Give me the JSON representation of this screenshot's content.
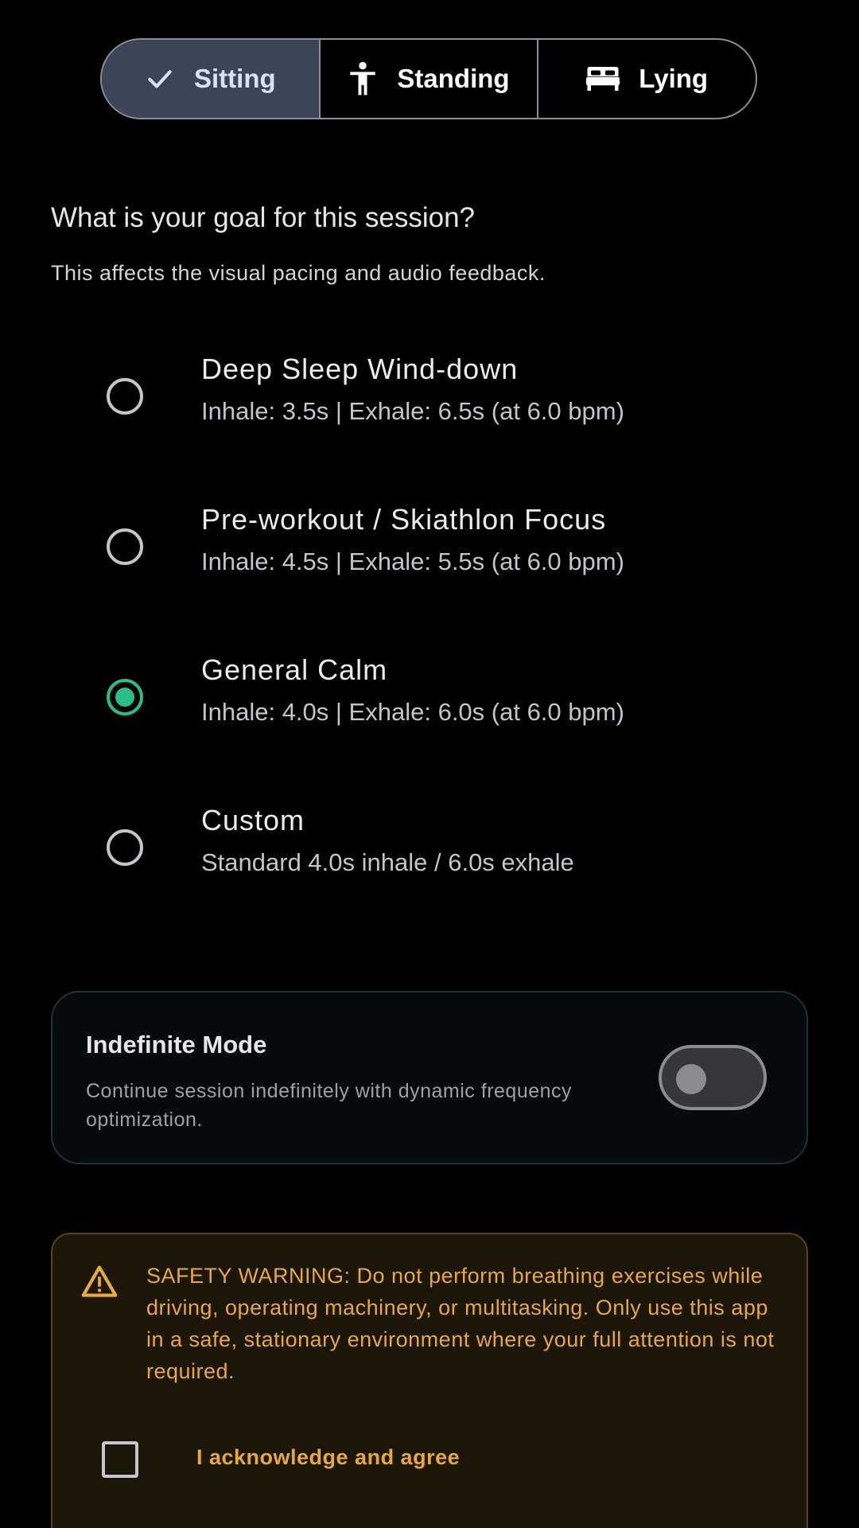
{
  "posture": {
    "options": [
      {
        "label": "Sitting",
        "icon": "check-icon",
        "selected": true
      },
      {
        "label": "Standing",
        "icon": "person-standing-icon",
        "selected": false
      },
      {
        "label": "Lying",
        "icon": "bed-icon",
        "selected": false
      }
    ]
  },
  "goal": {
    "question": "What is your goal for this session?",
    "hint": "This affects the visual pacing and audio feedback.",
    "options": [
      {
        "title": "Deep Sleep Wind-down",
        "subtitle": "Inhale: 3.5s | Exhale: 6.5s (at 6.0 bpm)",
        "checked": false
      },
      {
        "title": "Pre-workout / Skiathlon Focus",
        "subtitle": "Inhale: 4.5s | Exhale: 5.5s (at 6.0 bpm)",
        "checked": false
      },
      {
        "title": "General Calm",
        "subtitle": "Inhale: 4.0s | Exhale: 6.0s (at 6.0 bpm)",
        "checked": true
      },
      {
        "title": "Custom",
        "subtitle": "Standard 4.0s inhale / 6.0s exhale",
        "checked": false
      }
    ]
  },
  "indefinite_mode": {
    "title": "Indefinite Mode",
    "description": "Continue session indefinitely with dynamic frequency optimization.",
    "enabled": false
  },
  "safety": {
    "icon": "warning-triangle-icon",
    "text": "SAFETY WARNING: Do not perform breathing exercises while driving, operating machinery, or multitasking. Only use this app in a safe, stationary environment where your full attention is not required.",
    "acknowledge_label": "I acknowledge and agree",
    "acknowledged": false
  },
  "colors": {
    "accent_green": "#2bbd84",
    "warning_amber": "#e6a93a",
    "segment_selected_bg": "#3b4556"
  }
}
